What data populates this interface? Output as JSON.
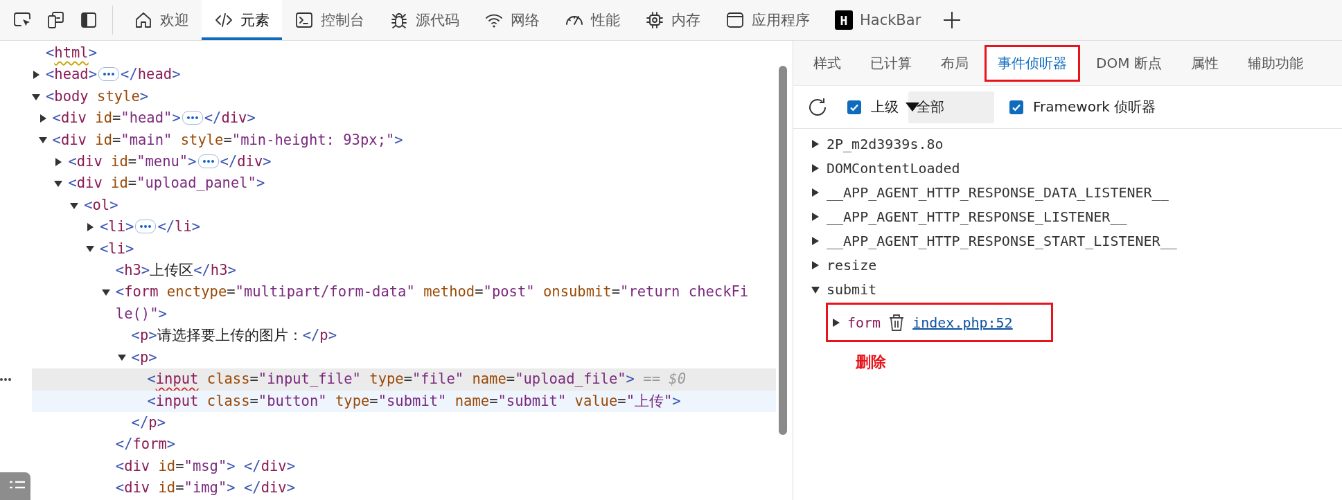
{
  "toolbar": {
    "tools": [
      {
        "kind": "inspect"
      },
      {
        "kind": "device"
      },
      {
        "kind": "dock"
      }
    ],
    "tabs": [
      {
        "label": "欢迎",
        "kind": "home",
        "selected": false
      },
      {
        "label": "元素",
        "kind": "code",
        "selected": true
      },
      {
        "label": "控制台",
        "kind": "console",
        "selected": false
      },
      {
        "label": "源代码",
        "kind": "bug",
        "selected": false
      },
      {
        "label": "网络",
        "kind": "wifi",
        "selected": false
      },
      {
        "label": "性能",
        "kind": "gauge",
        "selected": false
      },
      {
        "label": "内存",
        "kind": "chip",
        "selected": false
      },
      {
        "label": "应用程序",
        "kind": "window",
        "selected": false
      },
      {
        "label": "HackBar",
        "kind": "badge",
        "badge": "H",
        "selected": false
      }
    ]
  },
  "tree": [
    {
      "tokens": [
        {
          "kind": "punct",
          "text": "<"
        },
        {
          "kind": "tag-warning",
          "text": "html"
        },
        {
          "kind": "punct",
          "text": ">"
        }
      ],
      "selected": false,
      "hovered": false,
      "children": [
        {
          "expanded": false,
          "tokens": [
            {
              "kind": "punct",
              "text": "<"
            },
            {
              "kind": "tag",
              "text": "head"
            },
            {
              "kind": "punct",
              "text": ">"
            },
            {
              "kind": "ellipsis"
            },
            {
              "kind": "punct",
              "text": "</"
            },
            {
              "kind": "tag",
              "text": "head"
            },
            {
              "kind": "punct",
              "text": ">"
            }
          ],
          "selected": false,
          "hovered": false
        },
        {
          "expanded": true,
          "tokens": [
            {
              "kind": "punct",
              "text": "<"
            },
            {
              "kind": "tag",
              "text": "body"
            },
            {
              "kind": "attr",
              "text": " style"
            },
            {
              "kind": "punct",
              "text": ">"
            }
          ],
          "selected": false,
          "hovered": false,
          "children": [
            {
              "expanded": false,
              "tokens": [
                {
                  "kind": "punct",
                  "text": "<"
                },
                {
                  "kind": "tag",
                  "text": "div"
                },
                {
                  "kind": "attr",
                  "text": " id"
                },
                {
                  "kind": "eq",
                  "text": "="
                },
                {
                  "kind": "value",
                  "text": "\"head\""
                },
                {
                  "kind": "punct",
                  "text": ">"
                },
                {
                  "kind": "ellipsis"
                },
                {
                  "kind": "punct",
                  "text": "</"
                },
                {
                  "kind": "tag",
                  "text": "div"
                },
                {
                  "kind": "punct",
                  "text": ">"
                }
              ],
              "selected": false,
              "hovered": false
            },
            {
              "expanded": true,
              "tokens": [
                {
                  "kind": "punct",
                  "text": "<"
                },
                {
                  "kind": "tag",
                  "text": "div"
                },
                {
                  "kind": "attr",
                  "text": " id"
                },
                {
                  "kind": "eq",
                  "text": "="
                },
                {
                  "kind": "value",
                  "text": "\"main\""
                },
                {
                  "kind": "attr",
                  "text": " style"
                },
                {
                  "kind": "eq",
                  "text": "="
                },
                {
                  "kind": "value",
                  "text": "\"min-height: 93px;\""
                },
                {
                  "kind": "punct",
                  "text": ">"
                }
              ],
              "selected": false,
              "hovered": false,
              "children": [
                {
                  "expanded": false,
                  "tokens": [
                    {
                      "kind": "punct",
                      "text": "<"
                    },
                    {
                      "kind": "tag",
                      "text": "div"
                    },
                    {
                      "kind": "attr",
                      "text": " id"
                    },
                    {
                      "kind": "eq",
                      "text": "="
                    },
                    {
                      "kind": "value",
                      "text": "\"menu\""
                    },
                    {
                      "kind": "punct",
                      "text": ">"
                    },
                    {
                      "kind": "ellipsis"
                    },
                    {
                      "kind": "punct",
                      "text": "</"
                    },
                    {
                      "kind": "tag",
                      "text": "div"
                    },
                    {
                      "kind": "punct",
                      "text": ">"
                    }
                  ],
                  "selected": false,
                  "hovered": false
                },
                {
                  "expanded": true,
                  "tokens": [
                    {
                      "kind": "punct",
                      "text": "<"
                    },
                    {
                      "kind": "tag",
                      "text": "div"
                    },
                    {
                      "kind": "attr",
                      "text": " id"
                    },
                    {
                      "kind": "eq",
                      "text": "="
                    },
                    {
                      "kind": "value",
                      "text": "\"upload_panel\""
                    },
                    {
                      "kind": "punct",
                      "text": ">"
                    }
                  ],
                  "selected": false,
                  "hovered": false,
                  "children": [
                    {
                      "expanded": true,
                      "tokens": [
                        {
                          "kind": "punct",
                          "text": "<"
                        },
                        {
                          "kind": "tag",
                          "text": "ol"
                        },
                        {
                          "kind": "punct",
                          "text": ">"
                        }
                      ],
                      "selected": false,
                      "hovered": false,
                      "children": [
                        {
                          "expanded": false,
                          "tokens": [
                            {
                              "kind": "punct",
                              "text": "<"
                            },
                            {
                              "kind": "tag",
                              "text": "li"
                            },
                            {
                              "kind": "punct",
                              "text": ">"
                            },
                            {
                              "kind": "ellipsis"
                            },
                            {
                              "kind": "punct",
                              "text": "</"
                            },
                            {
                              "kind": "tag",
                              "text": "li"
                            },
                            {
                              "kind": "punct",
                              "text": ">"
                            }
                          ],
                          "selected": false,
                          "hovered": false
                        },
                        {
                          "expanded": true,
                          "tokens": [
                            {
                              "kind": "punct",
                              "text": "<"
                            },
                            {
                              "kind": "tag",
                              "text": "li"
                            },
                            {
                              "kind": "punct",
                              "text": ">"
                            }
                          ],
                          "selected": false,
                          "hovered": false,
                          "children": [
                            {
                              "tokens": [
                                {
                                  "kind": "punct",
                                  "text": "<"
                                },
                                {
                                  "kind": "tag",
                                  "text": "h3"
                                },
                                {
                                  "kind": "punct",
                                  "text": ">"
                                },
                                {
                                  "kind": "text",
                                  "text": "上传区"
                                },
                                {
                                  "kind": "punct",
                                  "text": "</"
                                },
                                {
                                  "kind": "tag",
                                  "text": "h3"
                                },
                                {
                                  "kind": "punct",
                                  "text": ">"
                                }
                              ],
                              "selected": false,
                              "hovered": false
                            },
                            {
                              "expanded": true,
                              "tokens": [
                                {
                                  "kind": "punct",
                                  "text": "<"
                                },
                                {
                                  "kind": "tag",
                                  "text": "form"
                                },
                                {
                                  "kind": "attr",
                                  "text": " enctype"
                                },
                                {
                                  "kind": "eq",
                                  "text": "="
                                },
                                {
                                  "kind": "value",
                                  "text": "\"multipart/form-data\""
                                },
                                {
                                  "kind": "attr",
                                  "text": " method"
                                },
                                {
                                  "kind": "eq",
                                  "text": "="
                                },
                                {
                                  "kind": "value",
                                  "text": "\"post\""
                                },
                                {
                                  "kind": "attr",
                                  "text": " onsubmit"
                                },
                                {
                                  "kind": "eq",
                                  "text": "="
                                },
                                {
                                  "kind": "value",
                                  "text": "\"return checkFi"
                                },
                                {
                                  "kind": "wrap"
                                },
                                {
                                  "kind": "value",
                                  "text": "le()\""
                                },
                                {
                                  "kind": "punct",
                                  "text": ">"
                                }
                              ],
                              "close": [
                                {
                                  "kind": "punct",
                                  "text": "</"
                                },
                                {
                                  "kind": "tag",
                                  "text": "form"
                                },
                                {
                                  "kind": "punct",
                                  "text": ">"
                                }
                              ],
                              "selected": false,
                              "hovered": false,
                              "children": [
                                {
                                  "tokens": [
                                    {
                                      "kind": "punct",
                                      "text": "<"
                                    },
                                    {
                                      "kind": "tag",
                                      "text": "p"
                                    },
                                    {
                                      "kind": "punct",
                                      "text": ">"
                                    },
                                    {
                                      "kind": "text",
                                      "text": "请选择要上传的图片："
                                    },
                                    {
                                      "kind": "punct",
                                      "text": "</"
                                    },
                                    {
                                      "kind": "tag",
                                      "text": "p"
                                    },
                                    {
                                      "kind": "punct",
                                      "text": ">"
                                    }
                                  ],
                                  "selected": false,
                                  "hovered": false
                                },
                                {
                                  "expanded": true,
                                  "tokens": [
                                    {
                                      "kind": "punct",
                                      "text": "<"
                                    },
                                    {
                                      "kind": "tag",
                                      "text": "p"
                                    },
                                    {
                                      "kind": "punct",
                                      "text": ">"
                                    }
                                  ],
                                  "close": [
                                    {
                                      "kind": "punct",
                                      "text": "</"
                                    },
                                    {
                                      "kind": "tag",
                                      "text": "p"
                                    },
                                    {
                                      "kind": "punct",
                                      "text": ">"
                                    }
                                  ],
                                  "selected": false,
                                  "hovered": false,
                                  "children": [
                                    {
                                      "tokens": [
                                        {
                                          "kind": "punct",
                                          "text": "<"
                                        },
                                        {
                                          "kind": "tag-error",
                                          "text": "input"
                                        },
                                        {
                                          "kind": "attr",
                                          "text": " class"
                                        },
                                        {
                                          "kind": "eq",
                                          "text": "="
                                        },
                                        {
                                          "kind": "value",
                                          "text": "\"input_file\""
                                        },
                                        {
                                          "kind": "attr",
                                          "text": " type"
                                        },
                                        {
                                          "kind": "eq",
                                          "text": "="
                                        },
                                        {
                                          "kind": "value",
                                          "text": "\"file\""
                                        },
                                        {
                                          "kind": "attr",
                                          "text": " name"
                                        },
                                        {
                                          "kind": "eq",
                                          "text": "="
                                        },
                                        {
                                          "kind": "value",
                                          "text": "\"upload_file\""
                                        },
                                        {
                                          "kind": "punct",
                                          "text": ">"
                                        },
                                        {
                                          "kind": "ref",
                                          "text": " == $0"
                                        }
                                      ],
                                      "selected": true,
                                      "hovered": false
                                    },
                                    {
                                      "tokens": [
                                        {
                                          "kind": "punct",
                                          "text": "<"
                                        },
                                        {
                                          "kind": "tag",
                                          "text": "input"
                                        },
                                        {
                                          "kind": "attr",
                                          "text": " class"
                                        },
                                        {
                                          "kind": "eq",
                                          "text": "="
                                        },
                                        {
                                          "kind": "value",
                                          "text": "\"button\""
                                        },
                                        {
                                          "kind": "attr",
                                          "text": " type"
                                        },
                                        {
                                          "kind": "eq",
                                          "text": "="
                                        },
                                        {
                                          "kind": "value",
                                          "text": "\"submit\""
                                        },
                                        {
                                          "kind": "attr",
                                          "text": " name"
                                        },
                                        {
                                          "kind": "eq",
                                          "text": "="
                                        },
                                        {
                                          "kind": "value",
                                          "text": "\"submit\""
                                        },
                                        {
                                          "kind": "attr",
                                          "text": " value"
                                        },
                                        {
                                          "kind": "eq",
                                          "text": "="
                                        },
                                        {
                                          "kind": "value",
                                          "text": "\"上传\""
                                        },
                                        {
                                          "kind": "punct",
                                          "text": ">"
                                        }
                                      ],
                                      "selected": false,
                                      "hovered": true
                                    }
                                  ]
                                }
                              ]
                            },
                            {
                              "tokens": [
                                {
                                  "kind": "punct",
                                  "text": "<"
                                },
                                {
                                  "kind": "tag",
                                  "text": "div"
                                },
                                {
                                  "kind": "attr",
                                  "text": " id"
                                },
                                {
                                  "kind": "eq",
                                  "text": "="
                                },
                                {
                                  "kind": "value",
                                  "text": "\"msg\""
                                },
                                {
                                  "kind": "punct",
                                  "text": "> </"
                                },
                                {
                                  "kind": "tag",
                                  "text": "div"
                                },
                                {
                                  "kind": "punct",
                                  "text": ">"
                                }
                              ],
                              "selected": false,
                              "hovered": false
                            },
                            {
                              "tokens": [
                                {
                                  "kind": "punct",
                                  "text": "<"
                                },
                                {
                                  "kind": "tag",
                                  "text": "div"
                                },
                                {
                                  "kind": "attr",
                                  "text": " id"
                                },
                                {
                                  "kind": "eq",
                                  "text": "="
                                },
                                {
                                  "kind": "value",
                                  "text": "\"img\""
                                },
                                {
                                  "kind": "punct",
                                  "text": "> </"
                                },
                                {
                                  "kind": "tag",
                                  "text": "div"
                                },
                                {
                                  "kind": "punct",
                                  "text": ">"
                                }
                              ],
                              "selected": false,
                              "hovered": false
                            }
                          ]
                        }
                      ]
                    }
                  ]
                }
              ]
            }
          ]
        }
      ]
    }
  ],
  "sidebar": {
    "tabs": [
      {
        "label": "样式",
        "selected": false,
        "annotated": false
      },
      {
        "label": "已计算",
        "selected": false,
        "annotated": false
      },
      {
        "label": "布局",
        "selected": false,
        "annotated": false
      },
      {
        "label": "事件侦听器",
        "selected": true,
        "annotated": true
      },
      {
        "label": "DOM 断点",
        "selected": false,
        "annotated": false
      },
      {
        "label": "属性",
        "selected": false,
        "annotated": false
      },
      {
        "label": "辅助功能",
        "selected": false,
        "annotated": false
      }
    ],
    "ancestors": {
      "label": "上级",
      "checked": true
    },
    "filter": {
      "value": "全部"
    },
    "framework": {
      "label": "Framework 侦听器",
      "checked": true
    },
    "listeners": [
      {
        "name": "2P_m2d3939s.8o",
        "expanded": false
      },
      {
        "name": "DOMContentLoaded",
        "expanded": false
      },
      {
        "name": "__APP_AGENT_HTTP_RESPONSE_DATA_LISTENER__",
        "expanded": false
      },
      {
        "name": "__APP_AGENT_HTTP_RESPONSE_LISTENER__",
        "expanded": false
      },
      {
        "name": "__APP_AGENT_HTTP_RESPONSE_START_LISTENER__",
        "expanded": false
      },
      {
        "name": "resize",
        "expanded": false
      },
      {
        "name": "submit",
        "expanded": true,
        "children": [
          {
            "element": "form",
            "link": "index.php:52",
            "expanded": false,
            "annotated": true
          }
        ]
      }
    ],
    "annotation_label": "删除"
  }
}
